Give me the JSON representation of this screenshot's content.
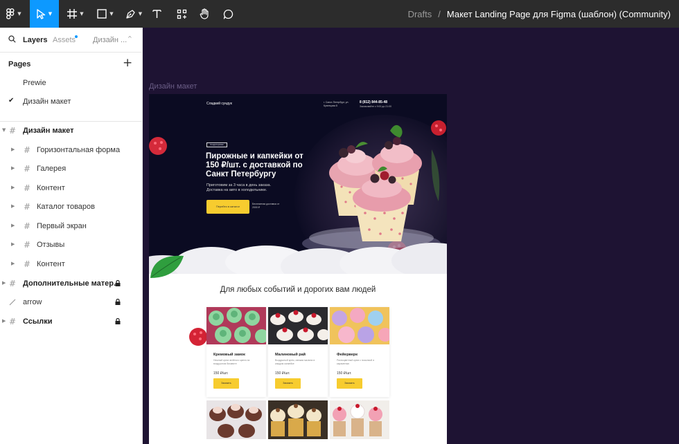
{
  "breadcrumb": {
    "drafts": "Drafts",
    "separator": "/",
    "file_title": "Макет Landing Page для Figma (шаблон) (Community)"
  },
  "toolbar": {
    "tools": [
      {
        "name": "figma-menu",
        "icon": "figma-logo-icon",
        "active": false
      },
      {
        "name": "move",
        "icon": "cursor-icon",
        "active": true
      },
      {
        "name": "frame",
        "icon": "hash-frame-icon",
        "active": false
      },
      {
        "name": "shape",
        "icon": "rectangle-icon",
        "active": false
      },
      {
        "name": "pen",
        "icon": "pen-icon",
        "active": false
      },
      {
        "name": "text",
        "icon": "text-icon",
        "active": false
      },
      {
        "name": "resources",
        "icon": "components-icon",
        "active": false
      },
      {
        "name": "hand",
        "icon": "hand-icon",
        "active": false
      },
      {
        "name": "comment",
        "icon": "comment-icon",
        "active": false
      }
    ],
    "accent": "#0d99ff"
  },
  "panel": {
    "tabs": {
      "layers": "Layers",
      "assets": "Assets",
      "page_dropdown": "Дизайн ..."
    },
    "pages_heading": "Pages",
    "pages": [
      {
        "label": "Prewie",
        "selected": false
      },
      {
        "label": "Дизайн макет",
        "selected": true
      }
    ],
    "layers": [
      {
        "label": "Дизайн макет",
        "level": 0,
        "bold": true,
        "expanded": true,
        "locked": false,
        "icon": "frame-icon"
      },
      {
        "label": "Горизонтальная форма",
        "level": 1,
        "bold": false,
        "locked": false,
        "icon": "frame-icon"
      },
      {
        "label": "Галерея",
        "level": 1,
        "bold": false,
        "locked": false,
        "icon": "frame-icon"
      },
      {
        "label": "Контент",
        "level": 1,
        "bold": false,
        "locked": false,
        "icon": "frame-icon"
      },
      {
        "label": "Каталог товаров",
        "level": 1,
        "bold": false,
        "locked": false,
        "icon": "frame-icon"
      },
      {
        "label": "Первый экран",
        "level": 1,
        "bold": false,
        "locked": false,
        "icon": "frame-icon"
      },
      {
        "label": "Отзывы",
        "level": 1,
        "bold": false,
        "locked": false,
        "icon": "frame-icon"
      },
      {
        "label": "Контент",
        "level": 1,
        "bold": false,
        "locked": false,
        "icon": "frame-icon"
      },
      {
        "label": "Дополнительные матер...",
        "level": 0,
        "bold": true,
        "locked": true,
        "icon": "frame-icon"
      },
      {
        "label": "arrow",
        "level": 0,
        "bold": false,
        "locked": true,
        "icon": "line-icon"
      },
      {
        "label": "Ссылки",
        "level": 0,
        "bold": true,
        "locked": true,
        "icon": "frame-icon"
      }
    ]
  },
  "canvas": {
    "background": "#1e1333",
    "frame_label": "Дизайн макет",
    "hero": {
      "brand": "Сладкий сундук",
      "address": "г. Санкт-Петербург, ул. Кузнецова 8",
      "phone": "8 (812) 844-85-48",
      "phone_note": "Заказывайте с 9:00 до 21:00",
      "badge": "Кондитерская",
      "title": "Пирожные и капкейки от 150 ₽/шт. с доставкой по Санкт Петербургу",
      "text": "Приготовим за 3 часа в день заказа. Доставка на авто в холодильнике.",
      "button": "Перейти в каталог",
      "button_note": "Бесплатная доставка от 2000 ₽"
    },
    "section_title": "Для любых событий и дорогих вам людей",
    "cards": [
      {
        "name": "Кремовый замок",
        "desc": "Нежный крем зелёного цвета на воздушном бисквите",
        "price": "150 ₽/шт.",
        "button": "Заказать"
      },
      {
        "name": "Малиновый рай",
        "desc": "Воздушный крем, свежая малина в каждом капкейке",
        "price": "150 ₽/шт.",
        "button": "Заказать"
      },
      {
        "name": "Фейерверк",
        "desc": "Разноцветный крем с посыпкой и карамелью",
        "price": "150 ₽/шт.",
        "button": "Заказать"
      }
    ],
    "accent_yellow": "#f7cc2f"
  }
}
